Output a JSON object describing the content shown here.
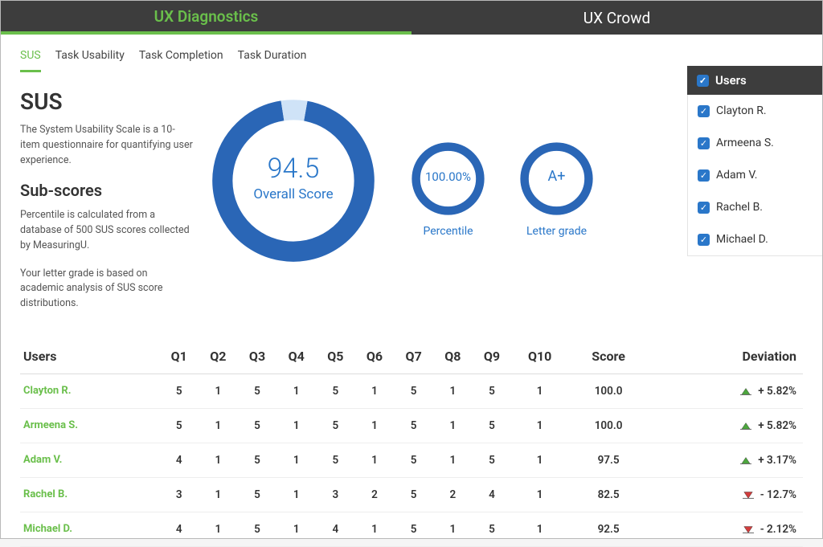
{
  "topTabs": {
    "diagnostics": "UX Diagnostics",
    "crowd": "UX Crowd"
  },
  "subTabs": {
    "sus": "SUS",
    "taskUsability": "Task Usability",
    "taskCompletion": "Task Completion",
    "taskDuration": "Task Duration"
  },
  "sidebar": {
    "title": "SUS",
    "desc": "The System Usability Scale is a 10-item questionnaire for quantifying user experience.",
    "subTitle": "Sub-scores",
    "subDesc1": "Percentile is calculated from a database of 500 SUS scores collected by MeasuringU.",
    "subDesc2": "Your letter grade is based on academic analysis of SUS score distributions."
  },
  "chart_data": {
    "type": "radial-gauge",
    "overall": {
      "value": "94.5",
      "label": "Overall Score"
    },
    "percentile": {
      "value": "100.00%",
      "label": "Percentile"
    },
    "grade": {
      "value": "A+",
      "label": "Letter grade"
    }
  },
  "usersPanel": {
    "title": "Users",
    "items": [
      {
        "name": "Clayton R.",
        "checked": true
      },
      {
        "name": "Armeena S.",
        "checked": true
      },
      {
        "name": "Adam V.",
        "checked": true
      },
      {
        "name": "Rachel B.",
        "checked": true
      },
      {
        "name": "Michael D.",
        "checked": true
      }
    ]
  },
  "table": {
    "headers": {
      "users": "Users",
      "q1": "Q1",
      "q2": "Q2",
      "q3": "Q3",
      "q4": "Q4",
      "q5": "Q5",
      "q6": "Q6",
      "q7": "Q7",
      "q8": "Q8",
      "q9": "Q9",
      "q10": "Q10",
      "score": "Score",
      "deviation": "Deviation"
    },
    "rows": [
      {
        "user": "Clayton R.",
        "q": [
          "5",
          "1",
          "5",
          "1",
          "5",
          "1",
          "5",
          "1",
          "5",
          "1"
        ],
        "score": "100.0",
        "dev": "+ 5.82%",
        "dir": "up"
      },
      {
        "user": "Armeena S.",
        "q": [
          "5",
          "1",
          "5",
          "1",
          "5",
          "1",
          "5",
          "1",
          "5",
          "1"
        ],
        "score": "100.0",
        "dev": "+ 5.82%",
        "dir": "up"
      },
      {
        "user": "Adam V.",
        "q": [
          "4",
          "1",
          "5",
          "1",
          "5",
          "1",
          "5",
          "1",
          "5",
          "1"
        ],
        "score": "97.5",
        "dev": "+ 3.17%",
        "dir": "up"
      },
      {
        "user": "Rachel B.",
        "q": [
          "3",
          "1",
          "5",
          "1",
          "3",
          "2",
          "5",
          "2",
          "4",
          "1"
        ],
        "score": "82.5",
        "dev": "- 12.7%",
        "dir": "down"
      },
      {
        "user": "Michael D.",
        "q": [
          "4",
          "1",
          "5",
          "1",
          "4",
          "1",
          "5",
          "1",
          "5",
          "1"
        ],
        "score": "92.5",
        "dev": "- 2.12%",
        "dir": "down"
      }
    ]
  }
}
